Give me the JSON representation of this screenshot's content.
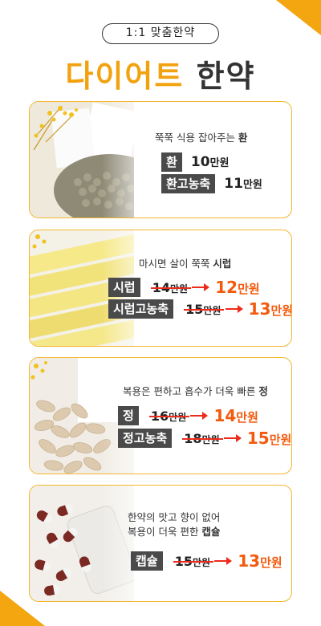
{
  "header": {
    "pill": "1:1 맞춤한약",
    "title_accent": "다이어트",
    "title_main": "한약"
  },
  "cards": [
    {
      "desc": [
        "쭉쭉 식용 잡아주는 "
      ],
      "desc_bold": "환",
      "rows": [
        {
          "tag": "환",
          "price": "10",
          "unit": "만원"
        },
        {
          "tag": "환고농축",
          "price": "11",
          "unit": "만원"
        }
      ]
    },
    {
      "desc": [
        "마시면 살이 쭉쭉 "
      ],
      "desc_bold": "시럽",
      "rows": [
        {
          "tag": "시럽",
          "old": "14",
          "old_unit": "만원",
          "new": "12",
          "new_unit": "만원"
        },
        {
          "tag": "시럽고농축",
          "old": "15",
          "old_unit": "만원",
          "new": "13",
          "new_unit": "만원"
        }
      ]
    },
    {
      "desc": [
        "복용은 편하고 흡수가 더욱 빠른 "
      ],
      "desc_bold": "정",
      "rows": [
        {
          "tag": "정",
          "old": "16",
          "old_unit": "만원",
          "new": "14",
          "new_unit": "만원"
        },
        {
          "tag": "정고농축",
          "old": "18",
          "old_unit": "만원",
          "new": "15",
          "new_unit": "만원"
        }
      ]
    },
    {
      "desc_line1": "한약의 맛고 향이 없어",
      "desc_line2": "복용이 더욱 편한 ",
      "desc_bold": "캡슐",
      "rows": [
        {
          "tag": "캡슐",
          "old": "15",
          "old_unit": "만원",
          "new": "13",
          "new_unit": "만원"
        }
      ]
    }
  ],
  "colors": {
    "accent": "#f2a20f",
    "sale": "#f25a0e",
    "strike": "#ee2b1b",
    "tag_bg": "#4a4a4a"
  }
}
